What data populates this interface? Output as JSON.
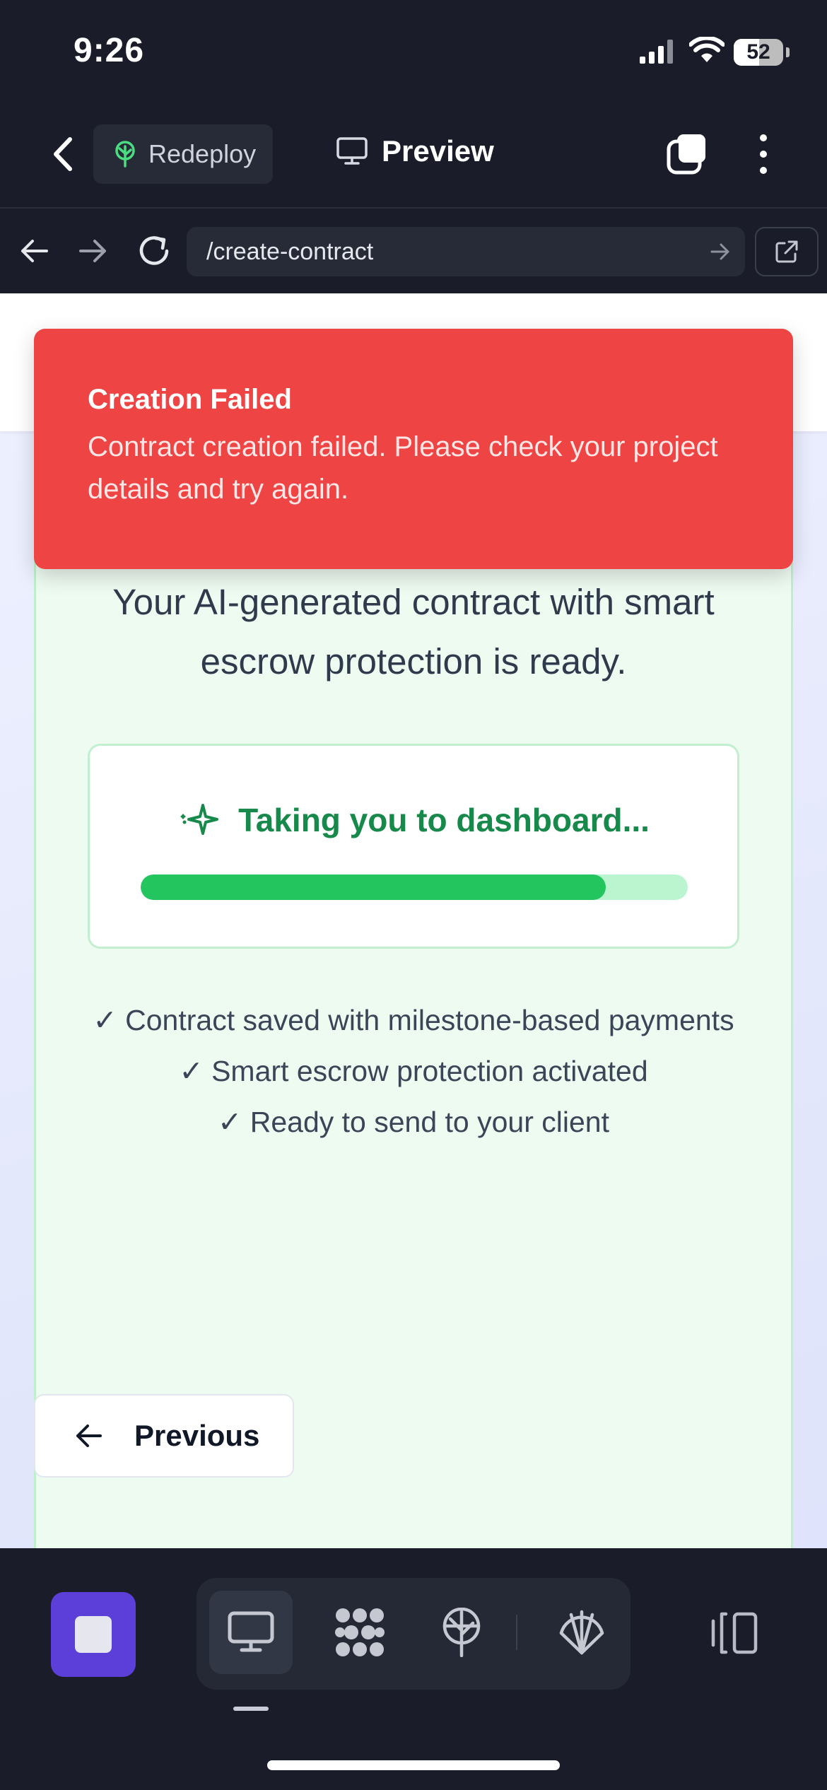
{
  "status_bar": {
    "time": "9:26",
    "battery_percent": "52",
    "battery_level": 0.52
  },
  "toolbar": {
    "redeploy_label": "Redeploy",
    "preview_label": "Preview"
  },
  "browser": {
    "url": "/create-contract"
  },
  "toast": {
    "title": "Creation Failed",
    "message": "Contract creation failed. Please check your project details and try again.",
    "background": "#ef4444"
  },
  "success_card": {
    "message": "Your AI-generated contract with smart escrow protection is ready.",
    "redirect_text": "Taking you to dashboard...",
    "progress": 0.85,
    "features": [
      "✓ Contract saved with milestone-based payments",
      "✓ Smart escrow protection activated",
      "✓ Ready to send to your client"
    ]
  },
  "navigation": {
    "previous_label": "Previous"
  },
  "colors": {
    "accent_green": "#22c55e",
    "success_text": "#17894a",
    "stop_button": "#5b3fd8",
    "dark_bg": "#1a1d29"
  },
  "icons": {
    "toolbar": [
      "chevron-left-icon",
      "redeploy-tree-icon",
      "monitor-icon",
      "tabs-icon",
      "more-vertical-icon"
    ],
    "browser": [
      "arrow-left-icon",
      "arrow-right-icon",
      "reload-icon",
      "go-arrow-icon",
      "external-link-icon"
    ],
    "bottom": [
      "stop-icon",
      "desktop-icon",
      "apps-icon",
      "deploy-icon",
      "shell-icon",
      "panel-icon"
    ],
    "content": [
      "sparkle-icon",
      "arrow-left-icon"
    ]
  }
}
